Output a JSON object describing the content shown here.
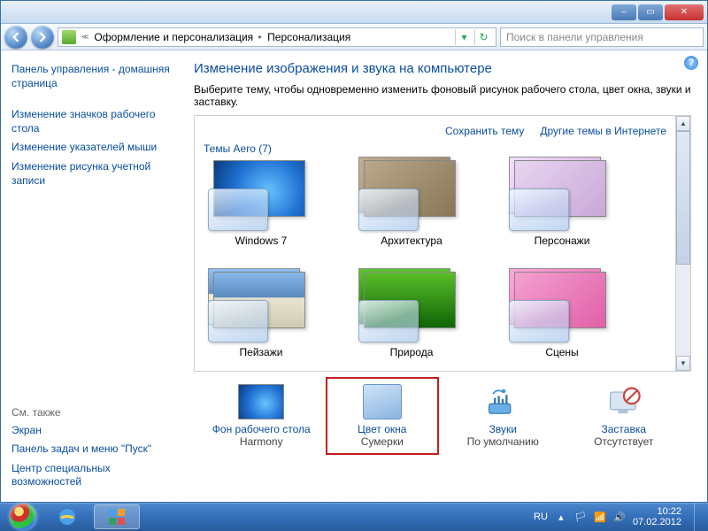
{
  "titlebar": {},
  "nav": {
    "crumb1": "Оформление и персонализация",
    "crumb2": "Персонализация",
    "search_placeholder": "Поиск в панели управления"
  },
  "sidebar": {
    "home": "Панель управления - домашняя страница",
    "links": [
      "Изменение значков рабочего стола",
      "Изменение указателей мыши",
      "Изменение рисунка учетной записи"
    ],
    "seealso_hdr": "См. также",
    "seealso": [
      "Экран",
      "Панель задач и меню \"Пуск\"",
      "Центр специальных возможностей"
    ]
  },
  "main": {
    "title": "Изменение изображения и звука на компьютере",
    "desc": "Выберите тему, чтобы одновременно изменить фоновый рисунок рабочего стола, цвет окна, звуки и заставку.",
    "save_theme": "Сохранить тему",
    "more_themes": "Другие темы в Интернете",
    "group_label": "Темы Aero (7)",
    "themes": [
      {
        "name": "Windows 7",
        "cls": "win7",
        "single": true
      },
      {
        "name": "Архитектура",
        "cls": "arch"
      },
      {
        "name": "Персонажи",
        "cls": "pers"
      },
      {
        "name": "Пейзажи",
        "cls": "land"
      },
      {
        "name": "Природа",
        "cls": "nat"
      },
      {
        "name": "Сцены",
        "cls": "scen"
      }
    ],
    "bottom": {
      "wallpaper": {
        "label": "Фон рабочего стола",
        "value": "Harmony"
      },
      "color": {
        "label": "Цвет окна",
        "value": "Сумерки"
      },
      "sounds": {
        "label": "Звуки",
        "value": "По умолчанию"
      },
      "saver": {
        "label": "Заставка",
        "value": "Отсутствует"
      }
    }
  },
  "taskbar": {
    "lang": "RU",
    "time": "10:22",
    "date": "07.02.2012"
  }
}
